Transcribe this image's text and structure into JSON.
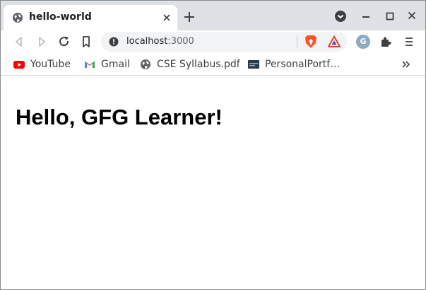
{
  "tab": {
    "title": "hello-world",
    "favicon": "globe-icon"
  },
  "toolbar": {
    "url_host": "localhost",
    "url_port": ":3000"
  },
  "profile": {
    "initial": "G",
    "color": "#8fa9bf"
  },
  "bookmarks": [
    {
      "label": "YouTube",
      "icon": "youtube-icon"
    },
    {
      "label": "Gmail",
      "icon": "gmail-icon"
    },
    {
      "label": "CSE Syllabus.pdf",
      "icon": "globe-icon"
    },
    {
      "label": "PersonalPortf…",
      "icon": "portfolio-favicon-icon"
    }
  ],
  "page": {
    "heading": "Hello, GFG Learner!"
  },
  "colors": {
    "tabstrip": "#dee1e6",
    "omnibox": "#f1f3f4",
    "brave_orange": "#fb542b"
  }
}
